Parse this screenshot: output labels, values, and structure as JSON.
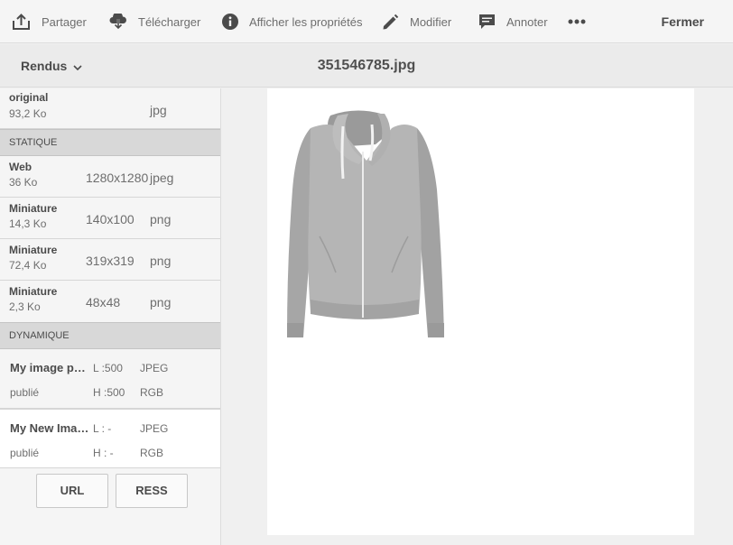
{
  "toolbar": {
    "share": "Partager",
    "download": "Télécharger",
    "properties": "Afficher les propriétés",
    "edit": "Modifier",
    "annotate": "Annoter",
    "close": "Fermer",
    "icons": [
      "share-icon",
      "download-icon",
      "info-icon",
      "pencil-icon",
      "comment-icon",
      "more-icon"
    ]
  },
  "header": {
    "dropdown_label": "Rendus",
    "file_name": "351546785.jpg"
  },
  "renditions": {
    "original": {
      "name": "original",
      "size": "93,2 Ko",
      "format": "jpg"
    },
    "static_label": "STATIQUE",
    "static_items": [
      {
        "name": "Web",
        "size": "36 Ko",
        "dimensions": "1280x1280",
        "format": "jpeg"
      },
      {
        "name": "Miniature",
        "size": "14,3 Ko",
        "dimensions": "140x100",
        "format": "png"
      },
      {
        "name": "Miniature",
        "size": "72,4 Ko",
        "dimensions": "319x319",
        "format": "png"
      },
      {
        "name": "Miniature",
        "size": "2,3 Ko",
        "dimensions": "48x48",
        "format": "png"
      }
    ],
    "dynamic_label": "DYNAMIQUE",
    "dynamic_items": [
      {
        "name": "My image preset",
        "status": "publié",
        "width": "L :500",
        "height": "H :500",
        "format": "JPEG",
        "color": "RGB"
      },
      {
        "name": "My New Image Preset",
        "status": "publié",
        "width": "L : -",
        "height": "H : -",
        "format": "JPEG",
        "color": "RGB"
      }
    ]
  },
  "buttons": {
    "url": "URL",
    "ress": "RESS"
  },
  "colors": {
    "panel_bg": "#f5f5f5",
    "section_bg": "#d8d8d8",
    "selected_bg": "#ffffff",
    "text": "#4b4b4b"
  }
}
